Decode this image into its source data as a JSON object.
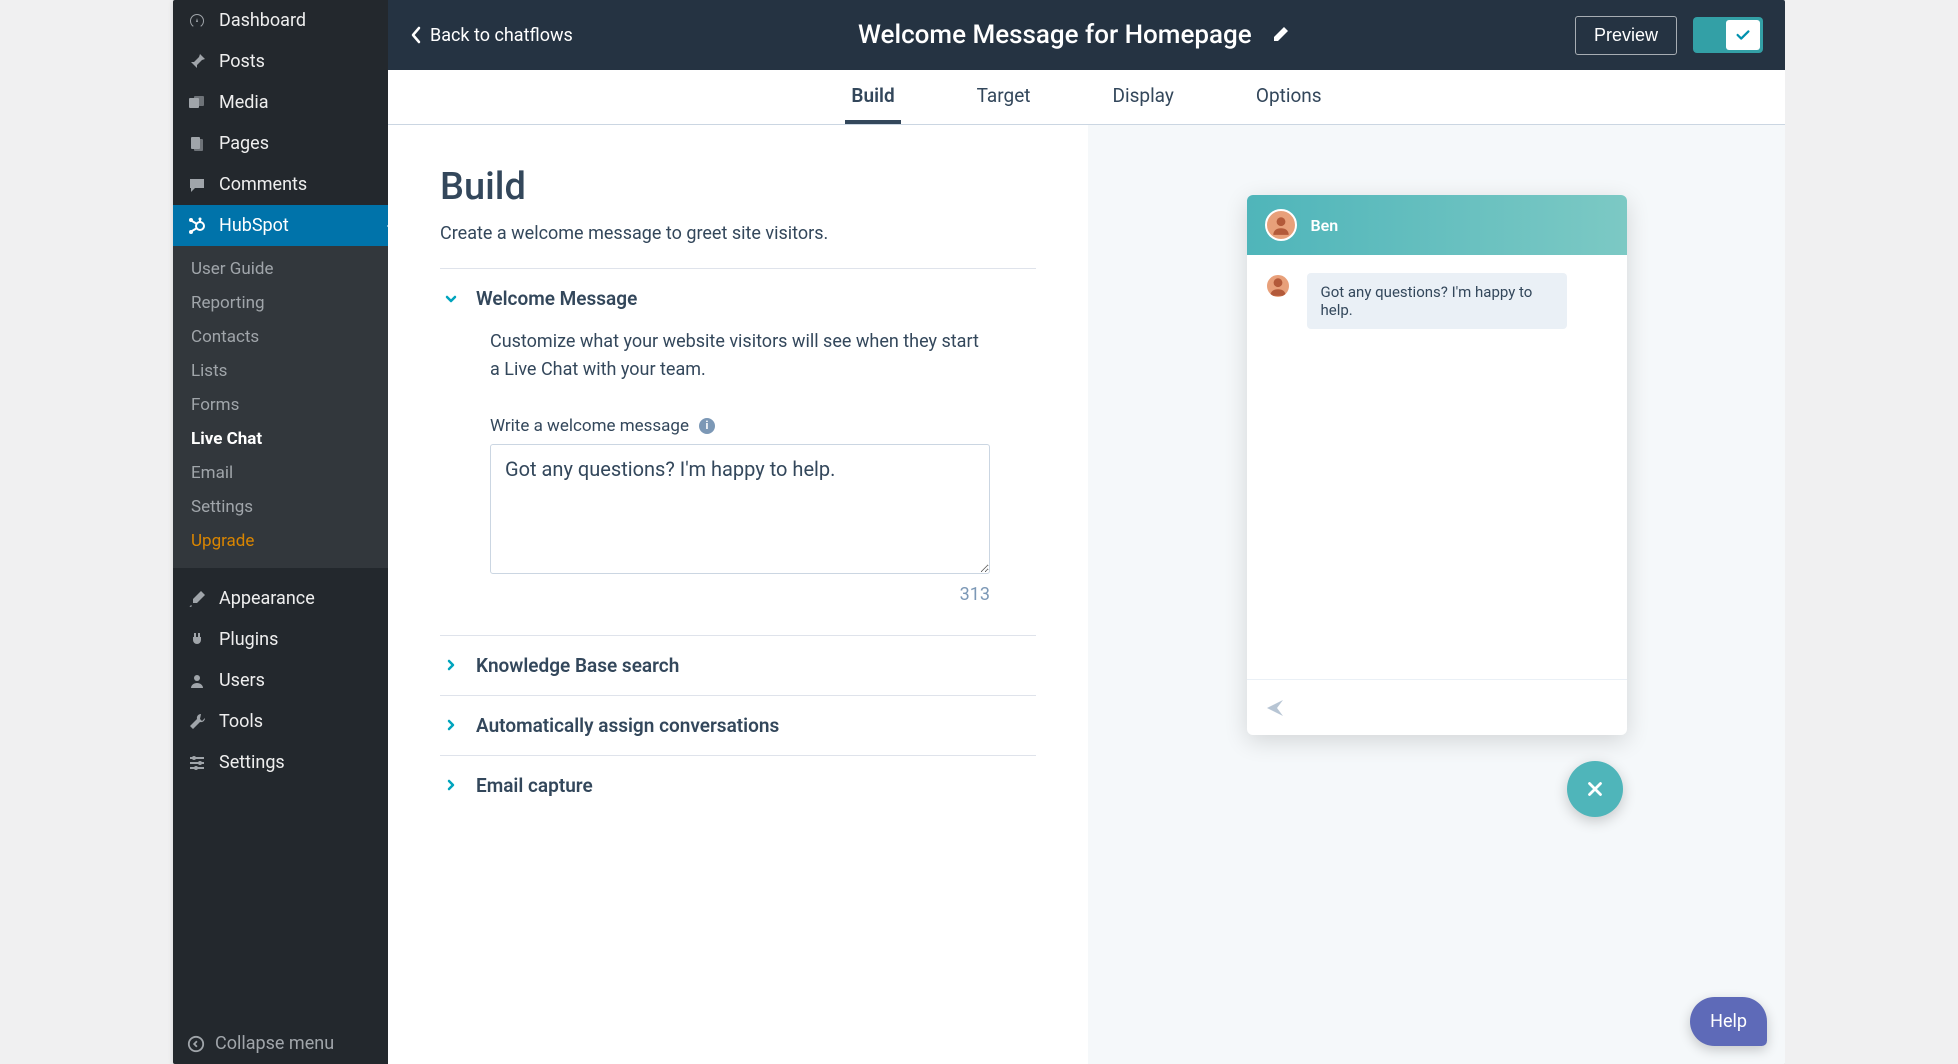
{
  "sidebar": {
    "items": [
      {
        "label": "Dashboard",
        "icon": "gauge"
      },
      {
        "label": "Posts",
        "icon": "pin"
      },
      {
        "label": "Media",
        "icon": "media"
      },
      {
        "label": "Pages",
        "icon": "pages"
      },
      {
        "label": "Comments",
        "icon": "comment"
      },
      {
        "label": "HubSpot",
        "icon": "hubspot",
        "active": true
      },
      {
        "label": "Appearance",
        "icon": "brush"
      },
      {
        "label": "Plugins",
        "icon": "plug"
      },
      {
        "label": "Users",
        "icon": "user"
      },
      {
        "label": "Tools",
        "icon": "wrench"
      },
      {
        "label": "Settings",
        "icon": "sliders"
      }
    ],
    "hubspot_sub": [
      {
        "label": "User Guide"
      },
      {
        "label": "Reporting"
      },
      {
        "label": "Contacts"
      },
      {
        "label": "Lists"
      },
      {
        "label": "Forms"
      },
      {
        "label": "Live Chat",
        "current": true
      },
      {
        "label": "Email"
      },
      {
        "label": "Settings"
      },
      {
        "label": "Upgrade",
        "upgrade": true
      }
    ],
    "collapse_label": "Collapse menu"
  },
  "header": {
    "back_label": "Back to chatflows",
    "title": "Welcome Message for Homepage",
    "preview_label": "Preview"
  },
  "tabs": [
    {
      "label": "Build",
      "active": true
    },
    {
      "label": "Target"
    },
    {
      "label": "Display"
    },
    {
      "label": "Options"
    }
  ],
  "build": {
    "heading": "Build",
    "subheading": "Create a welcome message to greet site visitors.",
    "sections": [
      {
        "label": "Welcome Message",
        "open": true
      },
      {
        "label": "Knowledge Base search"
      },
      {
        "label": "Automatically assign conversations"
      },
      {
        "label": "Email capture"
      }
    ],
    "welcome": {
      "help": "Customize what your website visitors will see when they start a Live Chat with your team.",
      "field_label": "Write a welcome message",
      "value": "Got any questions? I'm happy to help.",
      "counter": "313"
    }
  },
  "preview": {
    "agent_name": "Ben",
    "bubble_text": "Got any questions? I'm happy to help."
  },
  "help_label": "Help"
}
